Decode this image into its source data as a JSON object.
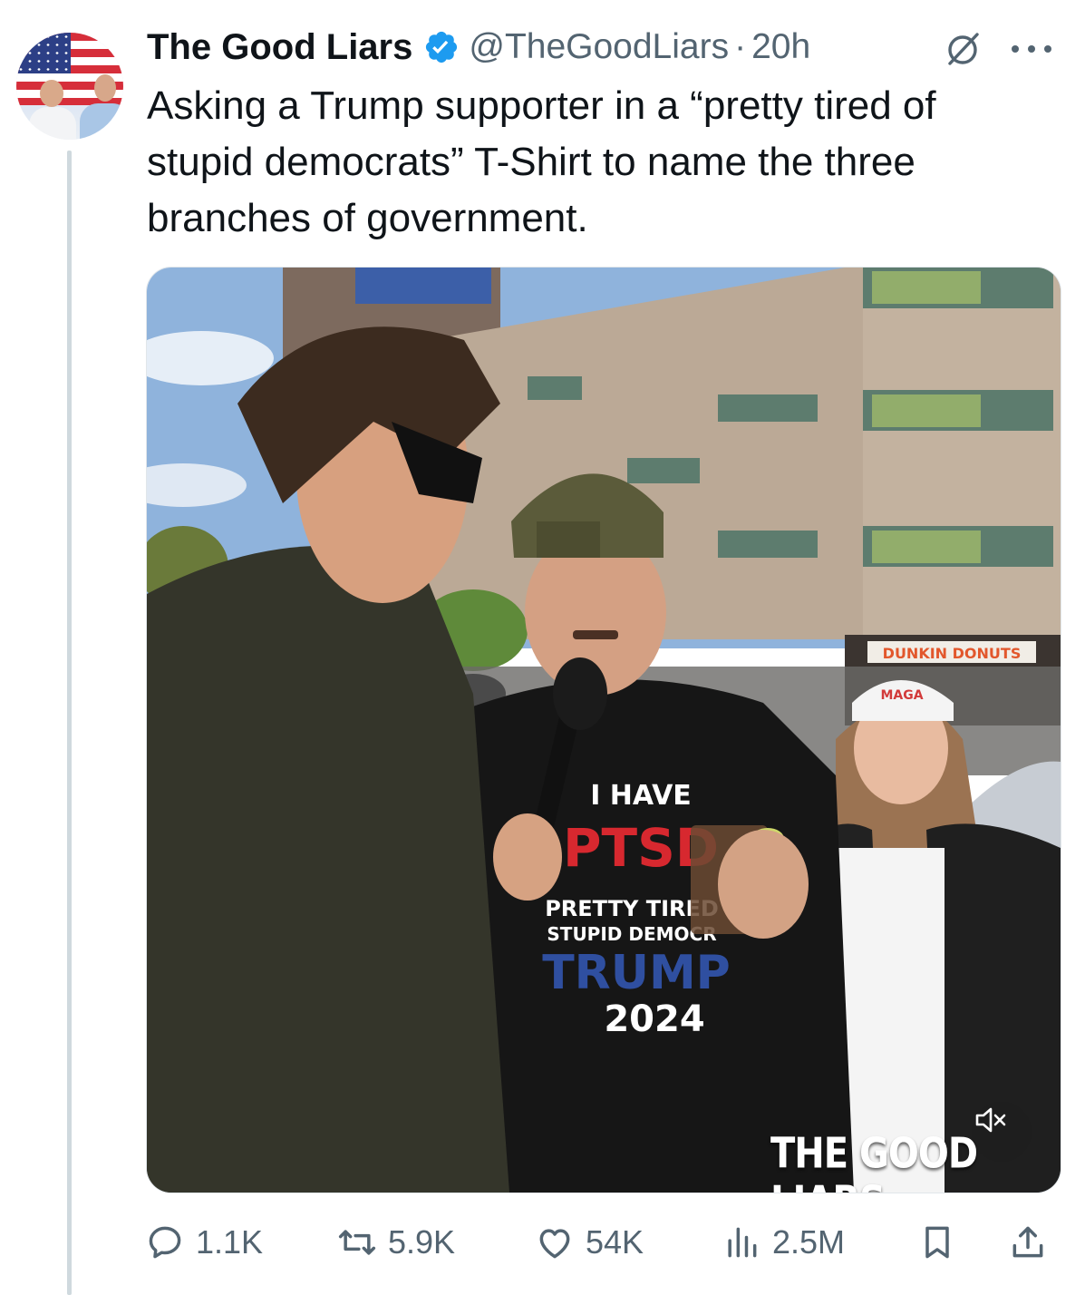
{
  "tweet": {
    "author": {
      "display_name": "The Good Liars",
      "handle": "@TheGoodLiars",
      "verified": true,
      "avatar_icon": "avatar-two-men-american-flag"
    },
    "separator": "·",
    "time": "20h",
    "text": "Asking a Trump supporter in a “pretty tired of stupid democrats” T-Shirt to name the three branches of government.",
    "media": {
      "type": "video",
      "watermark": "THE GOOD LIARS",
      "shirt_lines": [
        "I HAVE",
        "PTSD",
        "PRETTY TIRED",
        "STUPID DEMOCR",
        "TRUMP",
        "2024"
      ],
      "cap_text": "MAGA",
      "sign_text": "DUNKIN  DONUTS",
      "muted": true
    },
    "metrics": {
      "replies": "1.1K",
      "reposts": "5.9K",
      "likes": "54K",
      "views": "2.5M"
    }
  },
  "colors": {
    "text_primary": "#0f1419",
    "text_secondary": "#536471",
    "verified_blue": "#1d9bf0",
    "thread_line": "#cfd9de"
  },
  "icons": {
    "verified": "verified-badge-icon",
    "grok": "grok-icon",
    "more": "more-icon",
    "reply": "reply-icon",
    "repost": "repost-icon",
    "like": "like-icon",
    "views": "views-icon",
    "bookmark": "bookmark-icon",
    "share": "share-icon",
    "mute": "muted-speaker-icon"
  }
}
